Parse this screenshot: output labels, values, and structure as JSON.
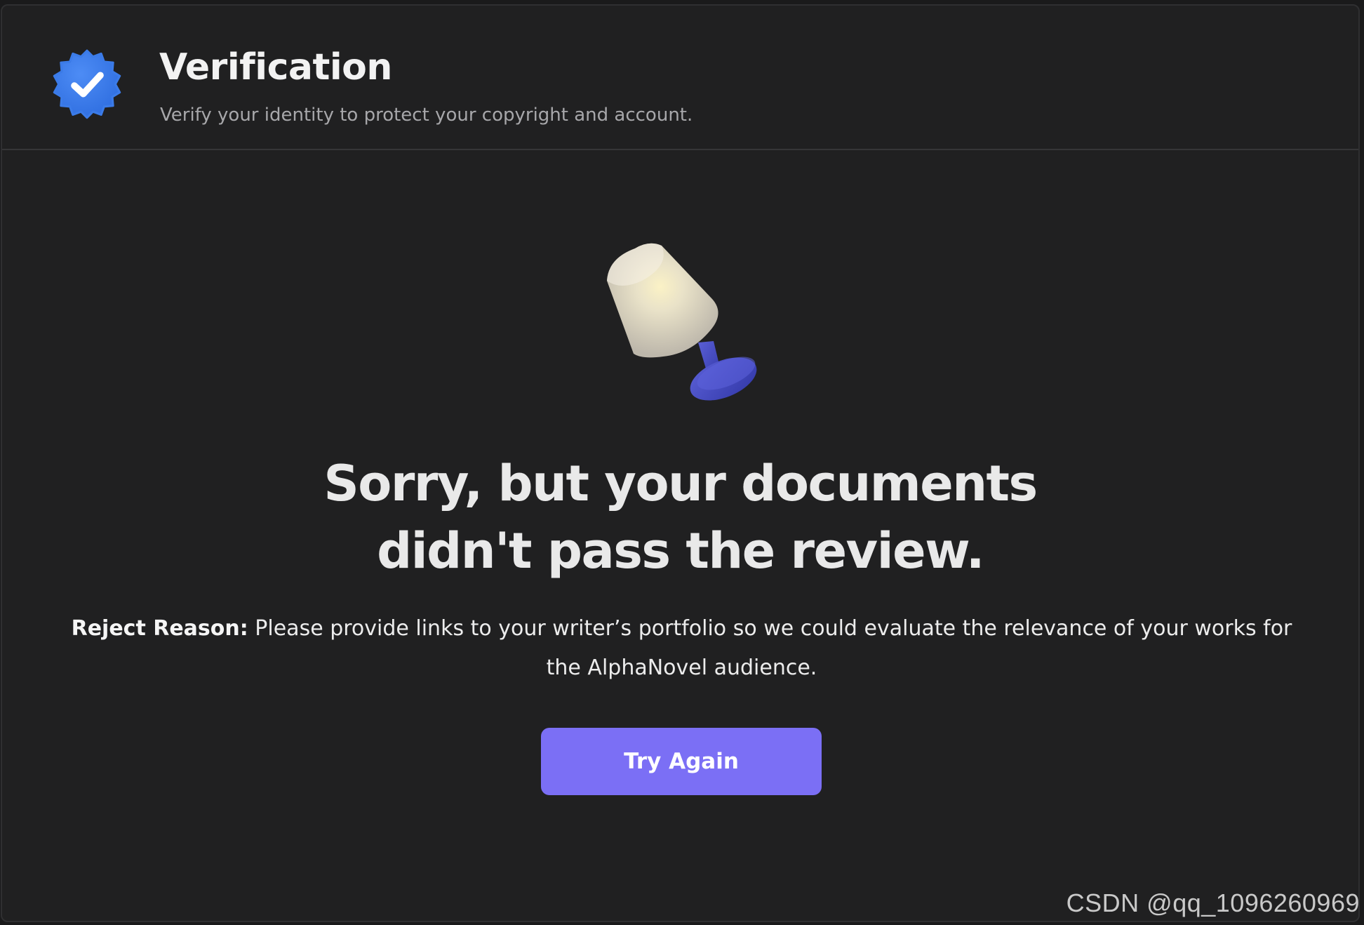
{
  "header": {
    "title": "Verification",
    "subtitle": "Verify your identity to protect your copyright and account.",
    "badge_icon": "verified-badge-icon",
    "badge_color": "#3b7be8"
  },
  "main": {
    "illustration": "table-lamp-icon",
    "headline_line1": "Sorry, but your documents",
    "headline_line2": "didn't pass the review.",
    "reason_label": "Reject Reason:",
    "reason_text": " Please provide links to your writer’s portfolio so we could evaluate the relevance of your works for the AlphaNovel audience.",
    "try_again_label": "Try Again",
    "accent_color": "#7b6ff5"
  },
  "watermark": "CSDN @qq_1096260969"
}
